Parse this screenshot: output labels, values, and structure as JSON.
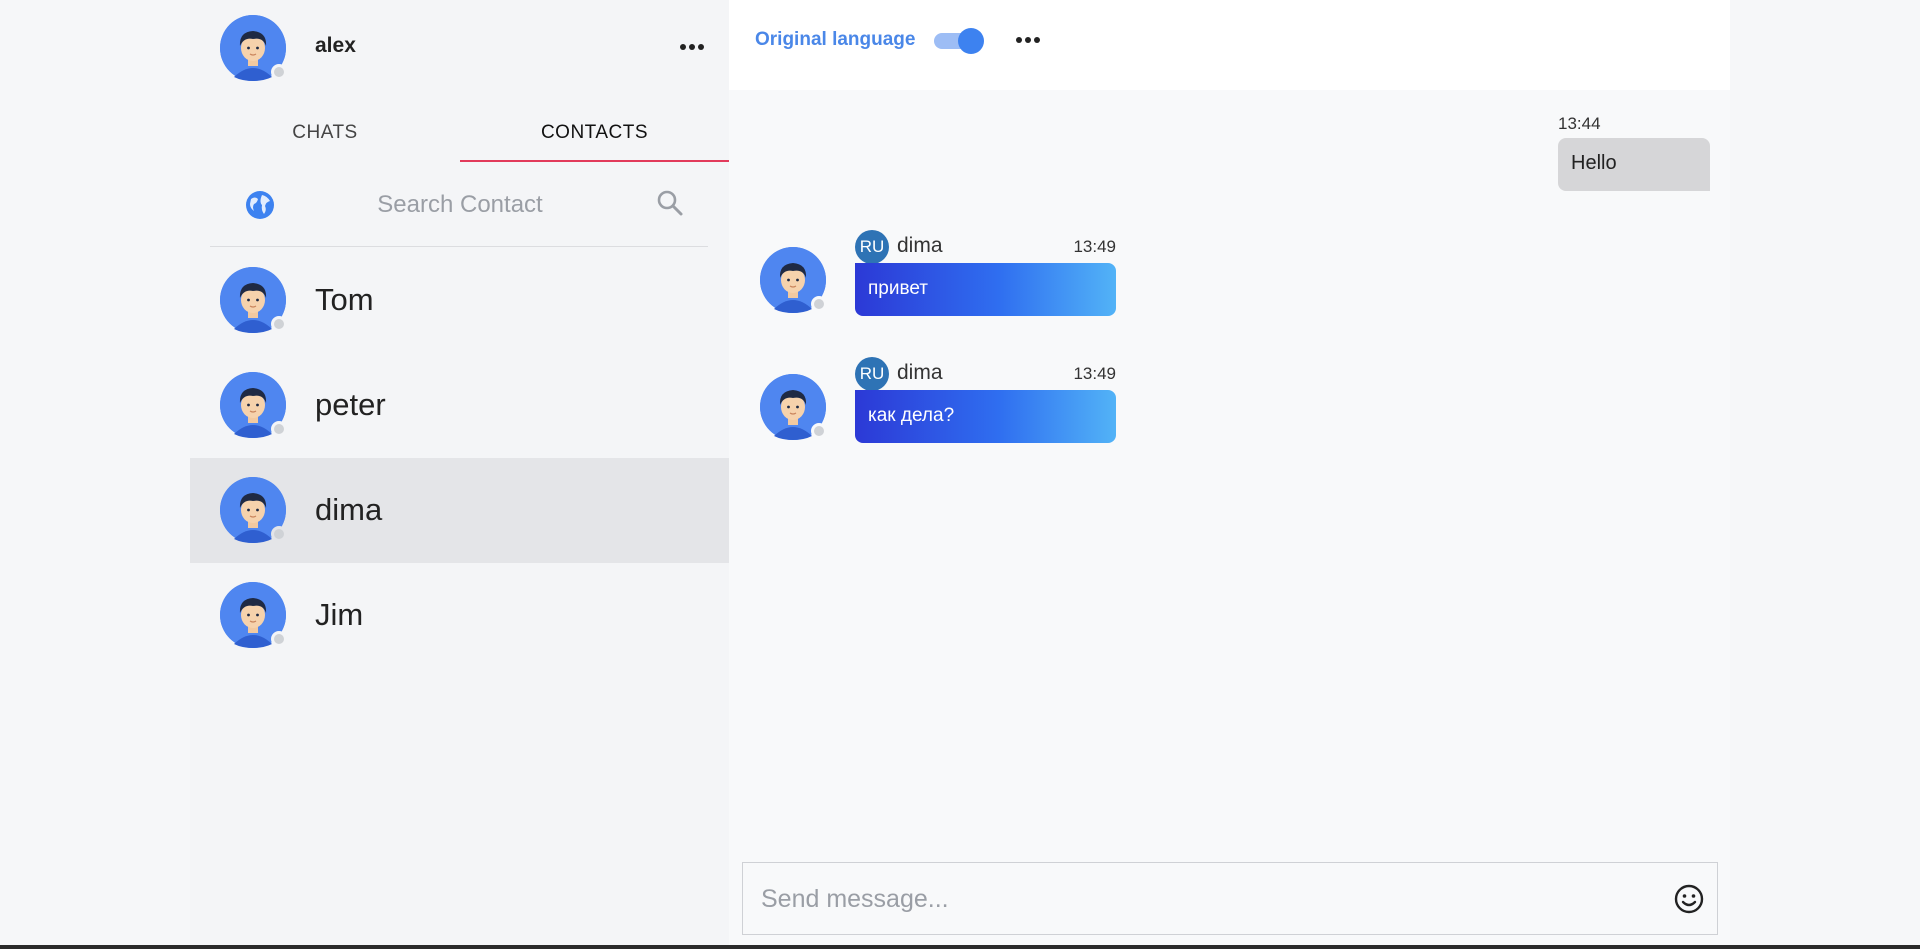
{
  "user": {
    "name": "alex"
  },
  "tabs": [
    {
      "label": "CHATS"
    },
    {
      "label": "CONTACTS"
    }
  ],
  "search": {
    "placeholder": "Search Contact"
  },
  "contacts": [
    {
      "name": "Tom"
    },
    {
      "name": "peter"
    },
    {
      "name": "dima"
    },
    {
      "name": "Jim"
    }
  ],
  "chat": {
    "original_language_label": "Original language",
    "original_language_enabled": true,
    "messages": [
      {
        "direction": "outgoing",
        "time": "13:44",
        "text": "Hello"
      },
      {
        "direction": "incoming",
        "sender": "dima",
        "lang": "RU",
        "time": "13:49",
        "text": "привет"
      },
      {
        "direction": "incoming",
        "sender": "dima",
        "lang": "RU",
        "time": "13:49",
        "text": "как дела?"
      }
    ],
    "composer_placeholder": "Send message..."
  },
  "colors": {
    "accent": "#4a87e8",
    "tab_underline": "#e23a5b",
    "lang_badge": "#2e73b5",
    "bubble_gradient_start": "#2c39d6",
    "bubble_gradient_end": "#52b3f7"
  },
  "icons": [
    "more-icon",
    "globe-icon",
    "search-icon",
    "emoji-icon",
    "avatar-icon"
  ]
}
